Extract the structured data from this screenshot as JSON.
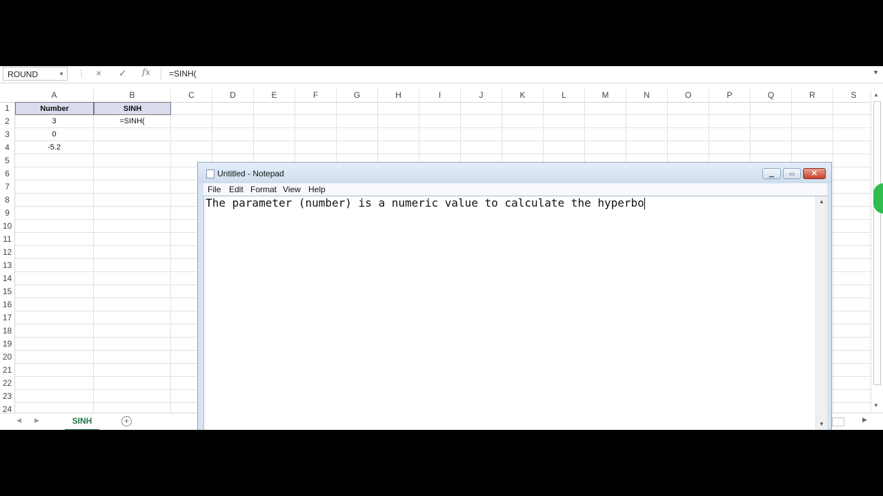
{
  "formula_bar": {
    "name_box": "ROUND",
    "cancel_icon": "×",
    "enter_icon": "✓",
    "fx_icon": "fx",
    "formula": "=SINH("
  },
  "columns": [
    "A",
    "B",
    "C",
    "D",
    "E",
    "F",
    "G",
    "H",
    "I",
    "J",
    "K",
    "L",
    "M",
    "N",
    "O",
    "P",
    "Q",
    "R",
    "S"
  ],
  "rows": [
    "1",
    "2",
    "3",
    "4",
    "5",
    "6",
    "7",
    "8",
    "9",
    "10",
    "11",
    "12",
    "13",
    "14",
    "15",
    "16",
    "17",
    "18",
    "19",
    "20",
    "21",
    "22",
    "23",
    "24"
  ],
  "cells": {
    "A1": "Number",
    "B1": "SINH",
    "A2": "3",
    "B2": "=SINH(",
    "A3": "0",
    "A4": "-5.2"
  },
  "sheet_tabs": [
    "SINH"
  ],
  "add_sheet_icon": "+",
  "notepad": {
    "title": "Untitled - Notepad",
    "menu": [
      "File",
      "Edit",
      "Format",
      "View",
      "Help"
    ],
    "text": "The parameter (number) is a numeric value to calculate the hyperbo"
  }
}
